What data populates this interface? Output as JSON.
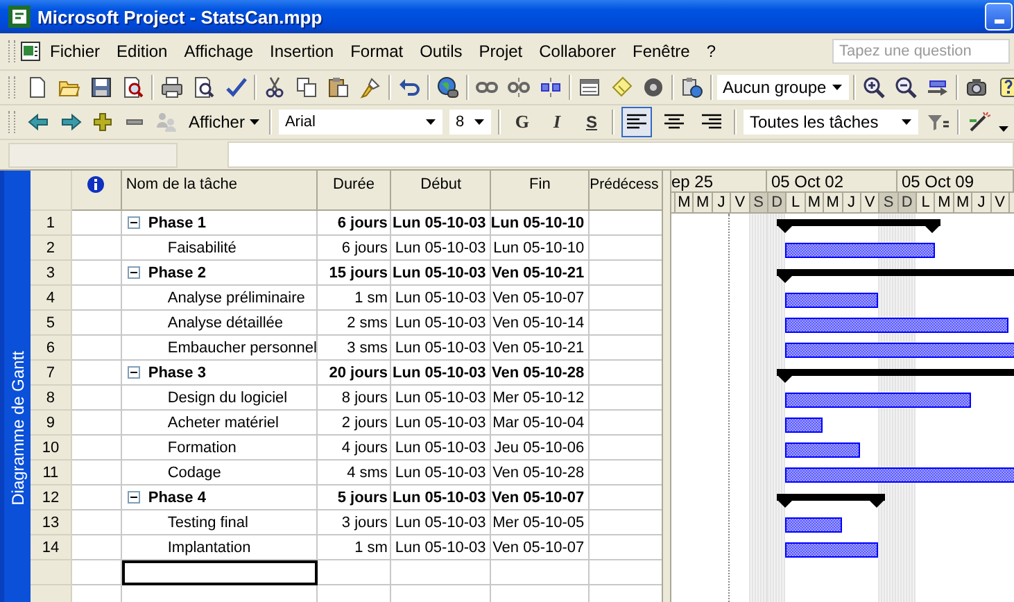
{
  "window": {
    "title": "Microsoft Project - StatsCan.mpp"
  },
  "menu": [
    "Fichier",
    "Edition",
    "Affichage",
    "Insertion",
    "Format",
    "Outils",
    "Projet",
    "Collaborer",
    "Fenêtre",
    "?"
  ],
  "help_search": {
    "placeholder": "Tapez une question"
  },
  "standard_toolbar": {
    "group": "Aucun groupe"
  },
  "formatting_toolbar": {
    "show_button": "Afficher",
    "font": "Arial",
    "font_size": "8",
    "bold": "G",
    "italic": "I",
    "underline": "S",
    "alignments": [
      {
        "kind": "left",
        "selected": true
      },
      {
        "kind": "center",
        "selected": false
      },
      {
        "kind": "right",
        "selected": false
      }
    ],
    "filter": "Toutes les tâches"
  },
  "view_bar": {
    "label": "Diagramme de Gantt"
  },
  "table": {
    "columns": [
      "Nom de la tâche",
      "Durée",
      "Début",
      "Fin",
      "Prédécess"
    ],
    "rows": [
      {
        "id": "1",
        "kind": "summary",
        "expanded": true,
        "name": "Phase 1",
        "duration": "6 jours",
        "start": "Lun 05-10-03",
        "end": "Lun 05-10-10"
      },
      {
        "id": "2",
        "kind": "task",
        "name": "Faisabilité",
        "duration": "6 jours",
        "start": "Lun 05-10-03",
        "end": "Lun 05-10-10"
      },
      {
        "id": "3",
        "kind": "summary",
        "expanded": true,
        "name": "Phase 2",
        "duration": "15 jours",
        "start": "Lun 05-10-03",
        "end": "Ven 05-10-21"
      },
      {
        "id": "4",
        "kind": "task",
        "name": "Analyse préliminaire",
        "duration": "1 sm",
        "start": "Lun 05-10-03",
        "end": "Ven 05-10-07"
      },
      {
        "id": "5",
        "kind": "task",
        "name": "Analyse détaillée",
        "duration": "2 sms",
        "start": "Lun 05-10-03",
        "end": "Ven 05-10-14"
      },
      {
        "id": "6",
        "kind": "task",
        "name": "Embaucher personnel",
        "duration": "3 sms",
        "start": "Lun 05-10-03",
        "end": "Ven 05-10-21"
      },
      {
        "id": "7",
        "kind": "summary",
        "expanded": true,
        "name": "Phase 3",
        "duration": "20 jours",
        "start": "Lun 05-10-03",
        "end": "Ven 05-10-28"
      },
      {
        "id": "8",
        "kind": "task",
        "name": "Design du logiciel",
        "duration": "8 jours",
        "start": "Lun 05-10-03",
        "end": "Mer 05-10-12"
      },
      {
        "id": "9",
        "kind": "task",
        "name": "Acheter matériel",
        "duration": "2 jours",
        "start": "Lun 05-10-03",
        "end": "Mar 05-10-04"
      },
      {
        "id": "10",
        "kind": "task",
        "name": "Formation",
        "duration": "4 jours",
        "start": "Lun 05-10-03",
        "end": "Jeu 05-10-06"
      },
      {
        "id": "11",
        "kind": "task",
        "name": "Codage",
        "duration": "4 sms",
        "start": "Lun 05-10-03",
        "end": "Ven 05-10-28"
      },
      {
        "id": "12",
        "kind": "summary",
        "expanded": true,
        "name": "Phase 4",
        "duration": "5 jours",
        "start": "Lun 05-10-03",
        "end": "Ven 05-10-07"
      },
      {
        "id": "13",
        "kind": "task",
        "name": "Testing final",
        "duration": "3 jours",
        "start": "Lun 05-10-03",
        "end": "Mer 05-10-05"
      },
      {
        "id": "14",
        "kind": "task",
        "name": "Implantation",
        "duration": "1 sm",
        "start": "Lun 05-10-03",
        "end": "Ven 05-10-07"
      }
    ],
    "empty_rows": [
      {
        "selected": true
      },
      {
        "selected": false
      }
    ]
  },
  "timeline": {
    "weeks": [
      "ep 25",
      "05 Oct 02",
      "05 Oct 09"
    ],
    "days": [
      {
        "label": "M",
        "weekend": false
      },
      {
        "label": "M",
        "weekend": false
      },
      {
        "label": "J",
        "weekend": false
      },
      {
        "label": "V",
        "weekend": false
      },
      {
        "label": "S",
        "weekend": true
      },
      {
        "label": "D",
        "weekend": true
      },
      {
        "label": "L",
        "weekend": false
      },
      {
        "label": "M",
        "weekend": false
      },
      {
        "label": "M",
        "weekend": false
      },
      {
        "label": "J",
        "weekend": false
      },
      {
        "label": "V",
        "weekend": false
      },
      {
        "label": "S",
        "weekend": true
      },
      {
        "label": "D",
        "weekend": true
      },
      {
        "label": "L",
        "weekend": false
      },
      {
        "label": "M",
        "weekend": false
      },
      {
        "label": "M",
        "weekend": false
      },
      {
        "label": "J",
        "weekend": false
      },
      {
        "label": "V",
        "weekend": false
      }
    ]
  }
}
